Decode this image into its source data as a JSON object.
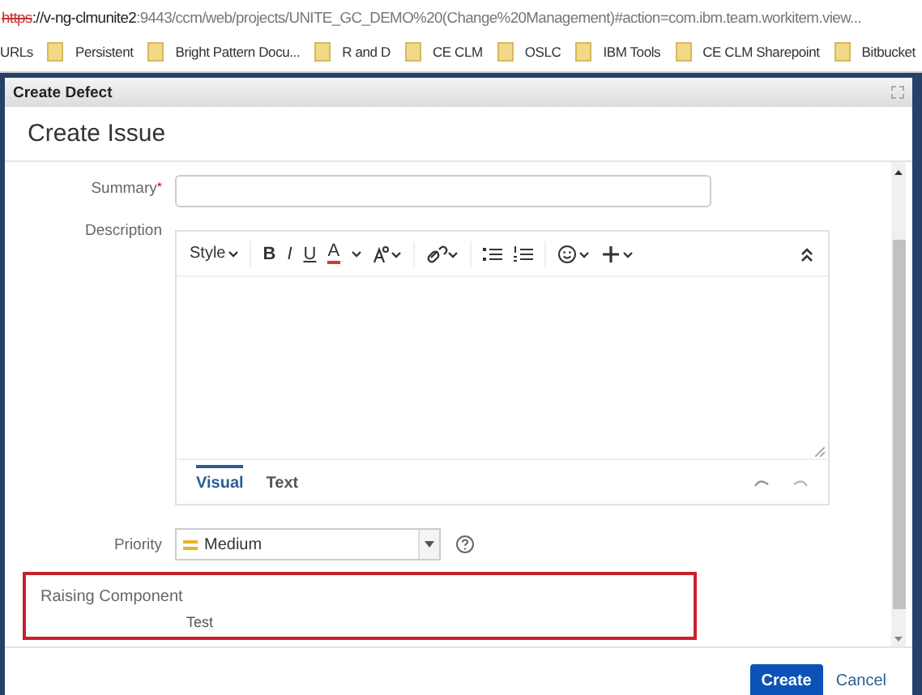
{
  "browser": {
    "url_scheme": "https",
    "url_host": "://v-ng-clmunite2",
    "url_rest": ":9443/ccm/web/projects/UNITE_GC_DEMO%20(Change%20Management)#action=com.ibm.team.workitem.view...",
    "bookmarks": [
      {
        "label": "URLs",
        "folder": false
      },
      {
        "label": "Persistent",
        "folder": true
      },
      {
        "label": "Bright Pattern Docu...",
        "folder": true
      },
      {
        "label": "R and D",
        "folder": true
      },
      {
        "label": "CE CLM",
        "folder": true
      },
      {
        "label": "OSLC",
        "folder": true
      },
      {
        "label": "IBM Tools",
        "folder": true
      },
      {
        "label": "CE CLM Sharepoint",
        "folder": true
      },
      {
        "label": "Bitbucket",
        "folder": true
      }
    ]
  },
  "dialog": {
    "title": "Create Defect",
    "heading": "Create Issue",
    "fields": [
      {
        "kind": "text",
        "label": "Summary",
        "required": true,
        "required_mark": "*"
      },
      {
        "kind": "editor",
        "label": "Description",
        "style": "Style",
        "format_buttons": [
          "B",
          "I",
          "U",
          "A"
        ],
        "tabs": [
          {
            "label": "Visual",
            "selected": true
          },
          {
            "label": "Text",
            "selected": false
          }
        ]
      },
      {
        "kind": "select",
        "label": "Priority",
        "value": "Medium"
      },
      {
        "kind": "readonly",
        "label": "Raising Component",
        "value": "Test",
        "highlighted": true
      }
    ],
    "buttons": [
      {
        "label": "Create",
        "primary": true
      },
      {
        "label": "Cancel",
        "primary": false
      }
    ]
  }
}
